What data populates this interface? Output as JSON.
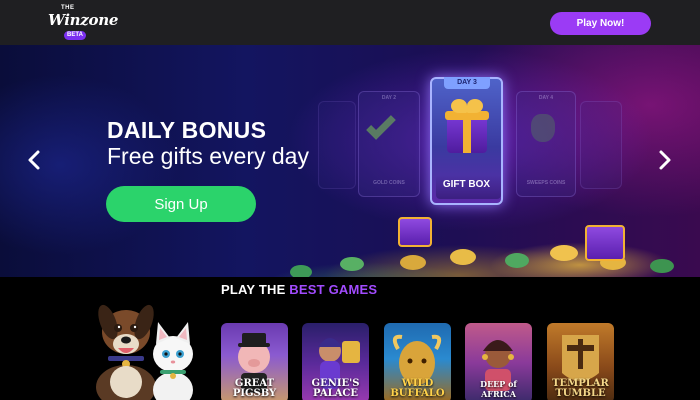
{
  "header": {
    "logo": {
      "top": "THE",
      "word": "Winzone",
      "badge": "BETA"
    },
    "cta_label": "Play Now!"
  },
  "hero": {
    "title": "DAILY BONUS",
    "subtitle": "Free gifts every day",
    "signup_label": "Sign Up",
    "cards": [
      {
        "day": "DAY 2",
        "label": "GOLD COINS"
      },
      {
        "day": "DAY 3",
        "label": "GIFT BOX"
      },
      {
        "day": "DAY 4",
        "label": "SWEEPS COINS"
      }
    ]
  },
  "games_section": {
    "heading_prefix": "PLAY THE",
    "heading_accent": "BEST GAMES",
    "games": [
      {
        "title": "GREAT PIGSBY",
        "sub": ""
      },
      {
        "title": "GENIE'S PALACE",
        "sub": ""
      },
      {
        "title": "WILD BUFFALO",
        "sub": ""
      },
      {
        "title": "DEEP of AFRICA",
        "sub": ""
      },
      {
        "title": "TEMPLAR TUMBLE",
        "sub": ""
      }
    ]
  },
  "colors": {
    "accent": "#9b3bf5",
    "signup": "#2bd36b",
    "header_bg": "#1f1f22"
  },
  "icons": [
    "chevron-left-icon",
    "chevron-right-icon",
    "gift-box-icon",
    "check-icon",
    "money-bag-icon"
  ]
}
